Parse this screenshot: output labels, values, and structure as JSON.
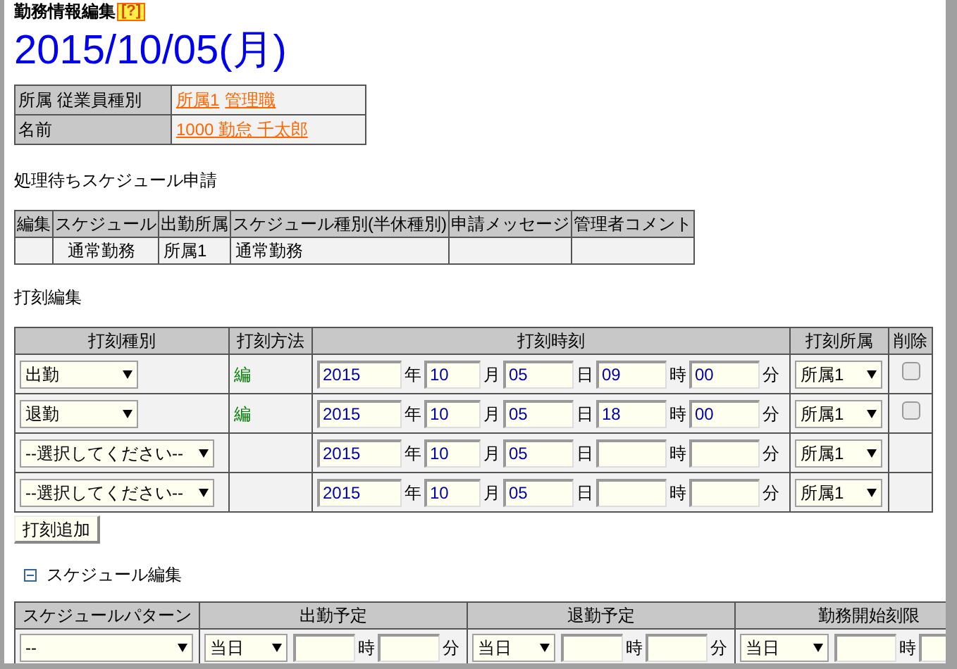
{
  "page_title": "勤務情報編集",
  "help_button": "[?]",
  "date_heading": "2015/10/05(月)",
  "info_table": [
    {
      "label": "所属 従業員種別",
      "links": [
        "所属1",
        "管理職"
      ]
    },
    {
      "label": "名前",
      "links": [
        "1000 勤怠 千太郎"
      ]
    }
  ],
  "pending_section": {
    "title": "処理待ちスケジュール申請",
    "columns": [
      "編集",
      "スケジュール",
      "出勤所属",
      "スケジュール種別(半休種別)",
      "申請メッセージ",
      "管理者コメント"
    ],
    "rows": [
      {
        "schedule": "通常勤務",
        "location": "所属1",
        "schedule_type": "通常勤務"
      }
    ]
  },
  "stamp_section": {
    "title": "打刻編集",
    "columns": [
      "打刻種別",
      "打刻方法",
      "打刻時刻",
      "打刻所属",
      "削除"
    ],
    "rows": [
      {
        "type": "出勤",
        "method": "編",
        "time_fields": [
          {
            "value": "2015",
            "unit": "年"
          },
          {
            "value": "10",
            "unit": "月"
          },
          {
            "value": "05",
            "unit": "日"
          },
          {
            "value": "09",
            "unit": "時"
          },
          {
            "value": "00",
            "unit": "分"
          }
        ],
        "location": "所属1",
        "delete_checked": false
      },
      {
        "type": "退勤",
        "method": "編",
        "time_fields": [
          {
            "value": "2015",
            "unit": "年"
          },
          {
            "value": "10",
            "unit": "月"
          },
          {
            "value": "05",
            "unit": "日"
          },
          {
            "value": "18",
            "unit": "時"
          },
          {
            "value": "00",
            "unit": "分"
          }
        ],
        "location": "所属1",
        "delete_checked": false
      },
      {
        "type": "--選択してください--",
        "time_fields": [
          {
            "value": "2015",
            "unit": "年"
          },
          {
            "value": "10",
            "unit": "月"
          },
          {
            "value": "05",
            "unit": "日"
          },
          {
            "unit": "時"
          },
          {
            "unit": "分"
          }
        ],
        "location": "所属1"
      },
      {
        "type": "--選択してください--",
        "time_fields": [
          {
            "value": "2015",
            "unit": "年"
          },
          {
            "value": "10",
            "unit": "月"
          },
          {
            "value": "05",
            "unit": "日"
          },
          {
            "unit": "時"
          },
          {
            "unit": "分"
          }
        ],
        "location": "所属1"
      }
    ],
    "add_button": "打刻追加"
  },
  "schedule_section": {
    "title": "スケジュール編集",
    "expanded": true,
    "columns": [
      "スケジュールパターン",
      "出勤予定",
      "退勤予定",
      "勤務開始刻限"
    ],
    "pattern": "--",
    "groups": [
      {
        "day": "当日",
        "units": [
          "時",
          "分"
        ]
      },
      {
        "day": "当日",
        "units": [
          "時",
          "分"
        ]
      },
      {
        "day": "当日",
        "units": [
          "時"
        ],
        "truncated": true
      }
    ]
  }
}
